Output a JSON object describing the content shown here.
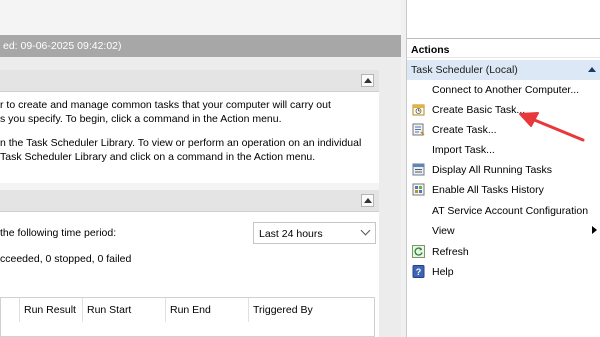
{
  "summary": {
    "header_text": "ed: 09-06-2025 09:42:02)"
  },
  "overview": {
    "lines": [
      "r to create and manage common tasks that your computer will carry out",
      "s you specify. To begin, click a command in the Action menu.",
      "n the Task Scheduler Library. To view or perform an operation on an individual",
      "Task Scheduler Library and click on a command in the Action menu."
    ]
  },
  "status": {
    "period_label": "the following time period:",
    "period_value": "Last 24 hours",
    "counts_text": "cceeded, 0 stopped, 0 failed",
    "columns": [
      "Run Result",
      "Run Start",
      "Run End",
      "Triggered By"
    ]
  },
  "actions": {
    "title": "Actions",
    "group": "Task Scheduler (Local)",
    "items": [
      {
        "label": "Connect to Another Computer...",
        "icon": "none"
      },
      {
        "label": "Create Basic Task...",
        "icon": "create-basic-task-icon"
      },
      {
        "label": "Create Task...",
        "icon": "create-task-icon"
      },
      {
        "label": "Import Task...",
        "icon": "none"
      },
      {
        "label": "Display All Running Tasks",
        "icon": "running-tasks-icon"
      },
      {
        "label": "Enable All Tasks History",
        "icon": "history-icon"
      },
      {
        "label": "AT Service Account Configuration",
        "icon": "none"
      },
      {
        "label": "View",
        "icon": "none"
      },
      {
        "label": "Refresh",
        "icon": "refresh-icon"
      },
      {
        "label": "Help",
        "icon": "help-icon"
      }
    ]
  },
  "colors": {
    "accent": "#dce8f5",
    "annotation_arrow": "#e8383b"
  }
}
